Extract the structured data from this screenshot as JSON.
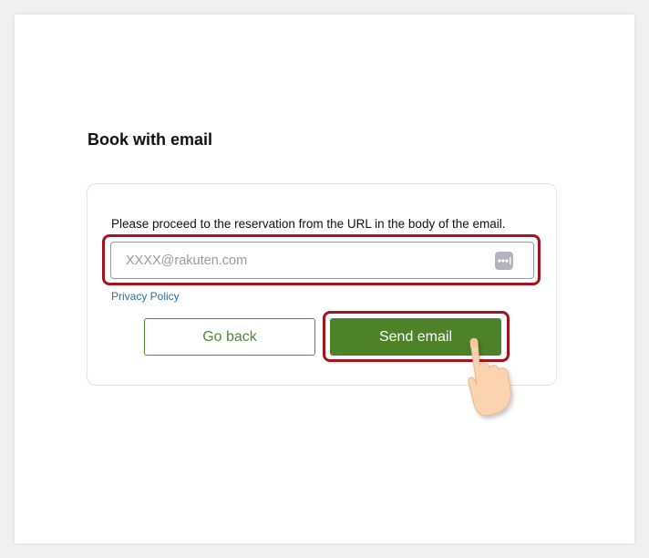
{
  "page": {
    "title": "Book with email"
  },
  "form": {
    "instruction": "Please proceed to the reservation from the URL in the body of the email.",
    "email_placeholder": "XXXX@rakuten.com",
    "email_value": "",
    "password_manager_icon": "password-dots-icon",
    "privacy_link": "Privacy Policy"
  },
  "buttons": {
    "go_back": "Go back",
    "send_email": "Send email"
  },
  "annotations": {
    "highlight_color": "#a4141c",
    "pointer_icon": "pointing-hand-icon"
  },
  "colors": {
    "primary_green": "#4d8228",
    "link_blue": "#2a6ea8"
  }
}
